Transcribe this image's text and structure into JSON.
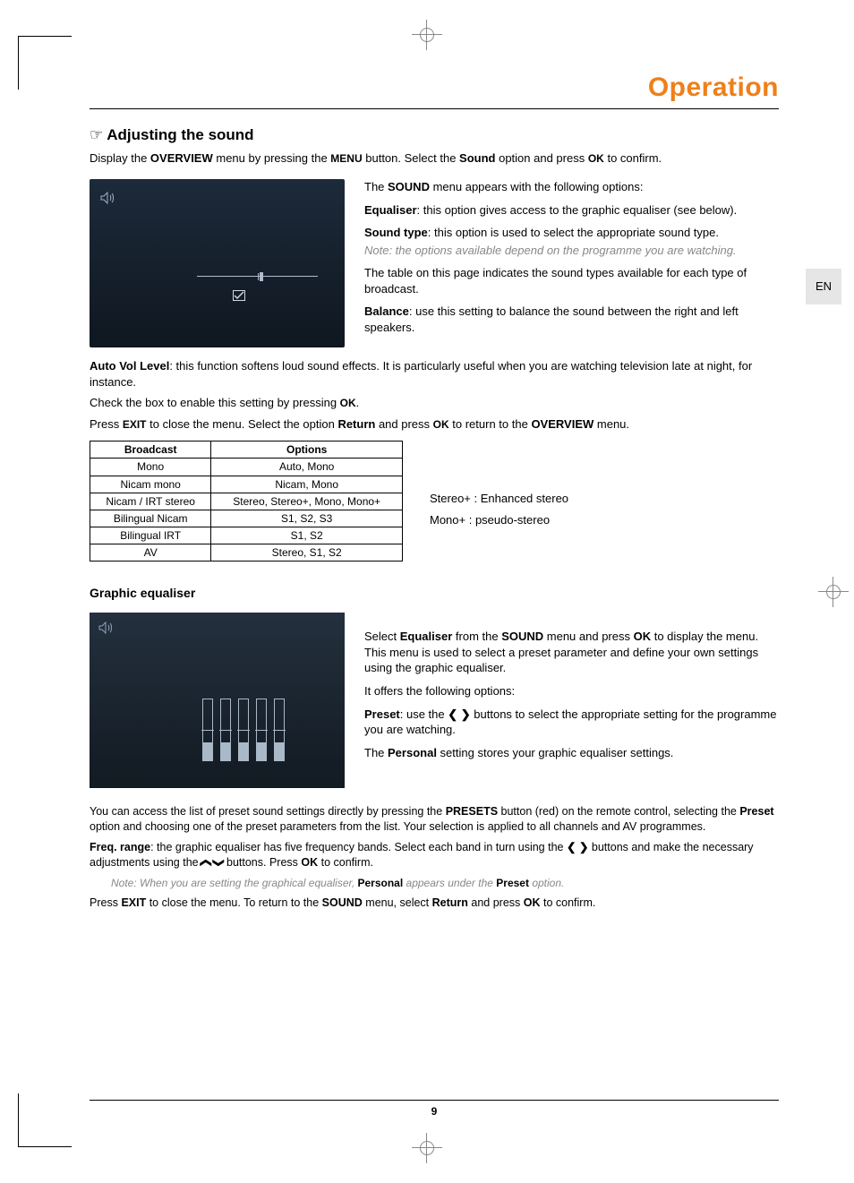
{
  "header": {
    "title": "Operation"
  },
  "lang_tab": "EN",
  "section": {
    "pointer_icon": "☞",
    "title": "Adjusting the sound",
    "intro_prefix": "Display the ",
    "intro_menu": "OVERVIEW",
    "intro_mid1": " menu by pressing the ",
    "intro_btn1": "MENU",
    "intro_mid2": " button. Select the ",
    "intro_opt": "Sound",
    "intro_mid3": " option and press ",
    "intro_btn2": "OK",
    "intro_end": " to confirm."
  },
  "sound_desc": {
    "p1a": "The ",
    "p1b": "SOUND",
    "p1c": " menu appears with the following options:",
    "p2a": "Equaliser",
    "p2b": ": this option gives access to the graphic equaliser (see below).",
    "p3a": "Sound type",
    "p3b": ": this option is used to select the appropriate sound type.",
    "p3note": "Note: the options available depend on the programme you are watching.",
    "p4": "The table on this page indicates the sound types available for each type of broadcast.",
    "p5a": "Balance",
    "p5b": ": use this setting to balance the sound between the right and left speakers."
  },
  "autovol": {
    "p1a": "Auto Vol Level",
    "p1b": ": this function softens loud sound effects. It is particularly useful when you are watching television late at night, for instance.",
    "p2a": "Check the box to enable this setting by pressing ",
    "p2b": "OK",
    "p2c": ".",
    "p3a": "Press ",
    "p3b": "EXIT",
    "p3c": " to close the menu. Select the option ",
    "p3d": "Return",
    "p3e": " and press ",
    "p3f": "OK",
    "p3g": " to return to the ",
    "p3h": "OVERVIEW",
    "p3i": " menu."
  },
  "table": {
    "head1": "Broadcast",
    "head2": "Options",
    "rows": [
      {
        "b": "Mono",
        "o": "Auto, Mono"
      },
      {
        "b": "Nicam mono",
        "o": "Nicam, Mono"
      },
      {
        "b": "Nicam / IRT stereo",
        "o": "Stereo, Stereo+, Mono, Mono+"
      },
      {
        "b": "Bilingual Nicam",
        "o": "S1, S2, S3"
      },
      {
        "b": "Bilingual IRT",
        "o": "S1, S2"
      },
      {
        "b": "AV",
        "o": "Stereo, S1, S2"
      }
    ],
    "side1": "Stereo+ : Enhanced stereo",
    "side2": "Mono+ : pseudo-stereo"
  },
  "eq": {
    "heading": "Graphic equaliser",
    "p1a": "Select ",
    "p1b": "Equaliser",
    "p1c": " from the ",
    "p1d": "SOUND",
    "p1e": " menu and press ",
    "p1f": "OK",
    "p1g": " to display the menu. This menu is used to select a preset parameter and define your own settings using the graphic equaliser.",
    "p2": "It offers the following options:",
    "p3a": "Preset",
    "p3b": ": use the ",
    "p3c": " buttons to select the appropriate setting for the programme you are watching.",
    "p4a": "The ",
    "p4b": "Personal",
    "p4c": " setting stores your graphic equaliser settings."
  },
  "footer": {
    "p1a": "You can access the list of preset sound settings directly by pressing the ",
    "p1b": "PRESETS",
    "p1c": " button (red) on the remote control, selecting the ",
    "p1d": "Preset",
    "p1e": " option and choosing one of the preset parameters from the list. Your selection is applied to all channels and AV programmes.",
    "p2a": "Freq. range",
    "p2b": ": the graphic equaliser has five frequency bands. Select each band in turn using the ",
    "p2c": " buttons and make the necessary adjustments using the ",
    "p2d": " buttons. Press ",
    "p2e": "OK",
    "p2f": " to confirm.",
    "note_a": "Note: When you are setting the graphical equaliser, ",
    "note_b": "Personal",
    "note_c": " appears under the ",
    "note_d": "Preset",
    "note_e": " option.",
    "p3a": "Press ",
    "p3b": "EXIT",
    "p3c": " to close the menu. To return to the ",
    "p3d": "SOUND",
    "p3e": " menu, select ",
    "p3f": "Return",
    "p3g": " and press ",
    "p3h": "OK",
    "p3i": " to confirm."
  },
  "arrows": {
    "left": "❮",
    "right": "❯",
    "up": "❮",
    "down": "❯"
  },
  "page_number": "9",
  "chart_data": {
    "type": "bar",
    "note": "equaliser screenshot bars (qualitative fill heights, 0-100 of bar height)",
    "categories": [
      "band1",
      "band2",
      "band3",
      "band4",
      "band5"
    ],
    "values": [
      30,
      30,
      30,
      30,
      30
    ]
  }
}
